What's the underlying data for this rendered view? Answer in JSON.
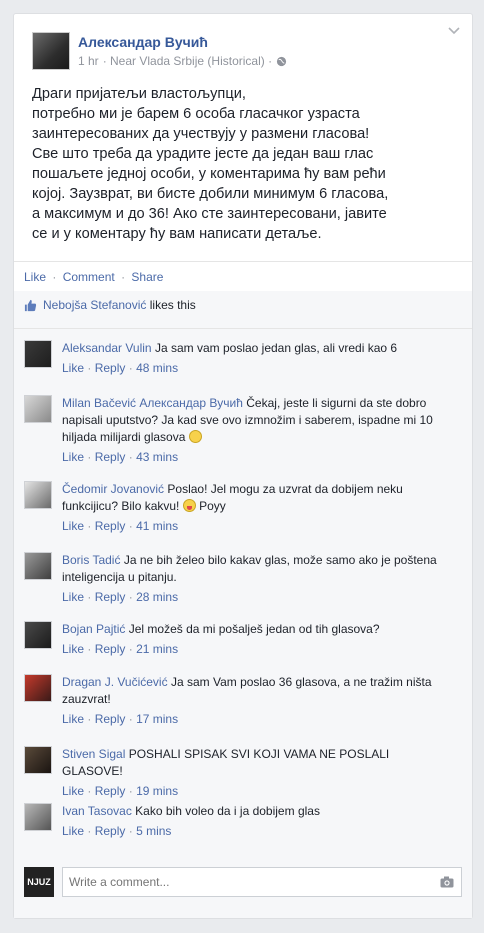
{
  "post": {
    "author": "Александар Вучић",
    "time": "1 hr",
    "location": "· Near Vlada Srbije (Historical) ·",
    "lines": [
      "Драги пријатељи властољупци,",
      "потребно ми је барем 6 особа гласачког узраста",
      "заинтересованих да учествују у размени гласова!",
      "Све што треба да урадите јесте да један ваш глас",
      "пошаљете једној особи, у коментарима ћу вам рећи",
      "којој. Заузврат, ви бисте добили минимум 6 гласова,",
      "а максимум и до 36! Ако сте заинтересовани, јавите",
      "се и у коментару ћу вам написати детаље."
    ]
  },
  "actions": {
    "like": "Like",
    "comment": "Comment",
    "share": "Share",
    "sep": "·"
  },
  "likes": {
    "name": "Nebojša Stefanović",
    "text": "likes this"
  },
  "comments": [
    {
      "name": "Aleksandar Vulin",
      "text": "Ja sam vam poslao jedan glas, ali vredi kao 6",
      "like": "Like",
      "reply": "Reply",
      "time": "48 mins"
    },
    {
      "name": "Milan Bačević",
      "tag": "Александар Вучић",
      "text": "Čekaj, jeste li sigurni da ste dobro napisali uputstvo? Ja kad sve ovo izmnožim i saberem, ispadne mi 10 hiljada milijardi glasova",
      "like": "Like",
      "reply": "Reply",
      "time": "43 mins"
    },
    {
      "name": "Čedomir Jovanović",
      "text": "Poslao! Jel mogu za uzvrat da dobijem neku funkcijicu? Bilo kakvu!",
      "extra": "Poyy",
      "like": "Like",
      "reply": "Reply",
      "time": "41 mins"
    },
    {
      "name": "Boris Tadić",
      "text": "Ja ne bih želeo bilo kakav glas, može samo ako je poštena inteligencija u pitanju.",
      "like": "Like",
      "reply": "Reply",
      "time": "28 mins"
    },
    {
      "name": "Bojan Pajtić",
      "text": "Jel možeš da mi pošalješ jedan od tih glasova?",
      "like": "Like",
      "reply": "Reply",
      "time": "21 mins"
    },
    {
      "name": "Dragan J. Vučićević",
      "text": "Ja sam Vam poslao 36 glasova, a ne tražim ništa zauzvrat!",
      "like": "Like",
      "reply": "Reply",
      "time": "17 mins"
    },
    {
      "name": "Stiven Sigal",
      "text": "POSHALI SPISAK SVI KOJI VAMA NE POSLALI GLASOVE!",
      "like": "Like",
      "reply": "Reply",
      "time": "19 mins"
    },
    {
      "name": "Ivan Tasovac",
      "text": "Kako bih voleo da i ja dobijem glas",
      "like": "Like",
      "reply": "Reply",
      "time": "5 mins"
    }
  ],
  "write": {
    "placeholder": "Write a comment...",
    "logo": "NJUZ"
  },
  "icons": {
    "chevron": "chevron-down-icon",
    "globe": "globe-icon",
    "thumb": "thumbs-up-icon",
    "camera": "camera-icon",
    "emoji": "smiley-icon"
  },
  "colors": {
    "link": "#4b6aa8",
    "name": "#365899",
    "meta": "#90949c",
    "bg": "#e9ebee"
  }
}
